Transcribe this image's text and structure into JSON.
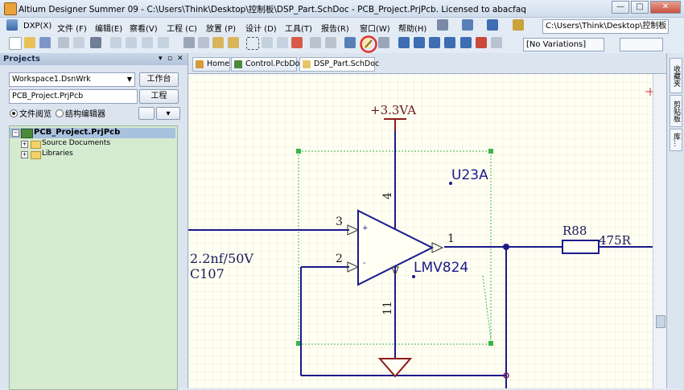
{
  "window": {
    "title": "Altium Designer Summer 09 - C:\\Users\\Think\\Desktop\\控制板\\DSP_Part.SchDoc - PCB_Project.PrjPcb. Licensed to abacfaq",
    "minimize": "—",
    "maximize": "□",
    "close": "✕"
  },
  "menu": {
    "items": [
      "DXP(X)",
      "文件 (F)",
      "编辑(E)",
      "察看(V)",
      "工程 (C)",
      "放置 (P)",
      "设计 (D)",
      "工具(T)",
      "报告(R)",
      "窗口(W)",
      "帮助(H)"
    ],
    "path": "C:\\Users\\Think\\Desktop\\控制板"
  },
  "toolbar": {
    "variations": "[No Variations]"
  },
  "projects_panel": {
    "title": "Projects",
    "workspace": "Workspace1.DsnWrk",
    "workspace_button": "工作台",
    "project": "PCB_Project.PrjPcb",
    "project_button": "工程",
    "view_file": "文件阅览",
    "view_struct": "结构编辑器",
    "tree": {
      "root": "PCB_Project.PrjPcb",
      "children": [
        "Source Documents",
        "Libraries"
      ]
    }
  },
  "tabs": [
    "Home",
    "Control.PcbDoc",
    "DSP_Part.SchDoc"
  ],
  "right_panel_tabs": [
    "收藏夹",
    "剪贴板",
    "库..."
  ],
  "schematic": {
    "power_label": "+3.3VA",
    "designator": "U23A",
    "part": "LMV824",
    "pins": {
      "p4": "4",
      "p3": "3",
      "p2": "2",
      "p1": "1",
      "p11": "11"
    },
    "plus": "+",
    "minus": "-",
    "resistor_designator": "R88",
    "resistor_value": "475R",
    "cap_value": "2.2nf/50V",
    "cap_designator": "C107"
  },
  "colors": {
    "wire": "#1a1a8c",
    "power": "#8b1a1a",
    "selection": "#39b54a",
    "highlight_circle": "#e23030"
  }
}
